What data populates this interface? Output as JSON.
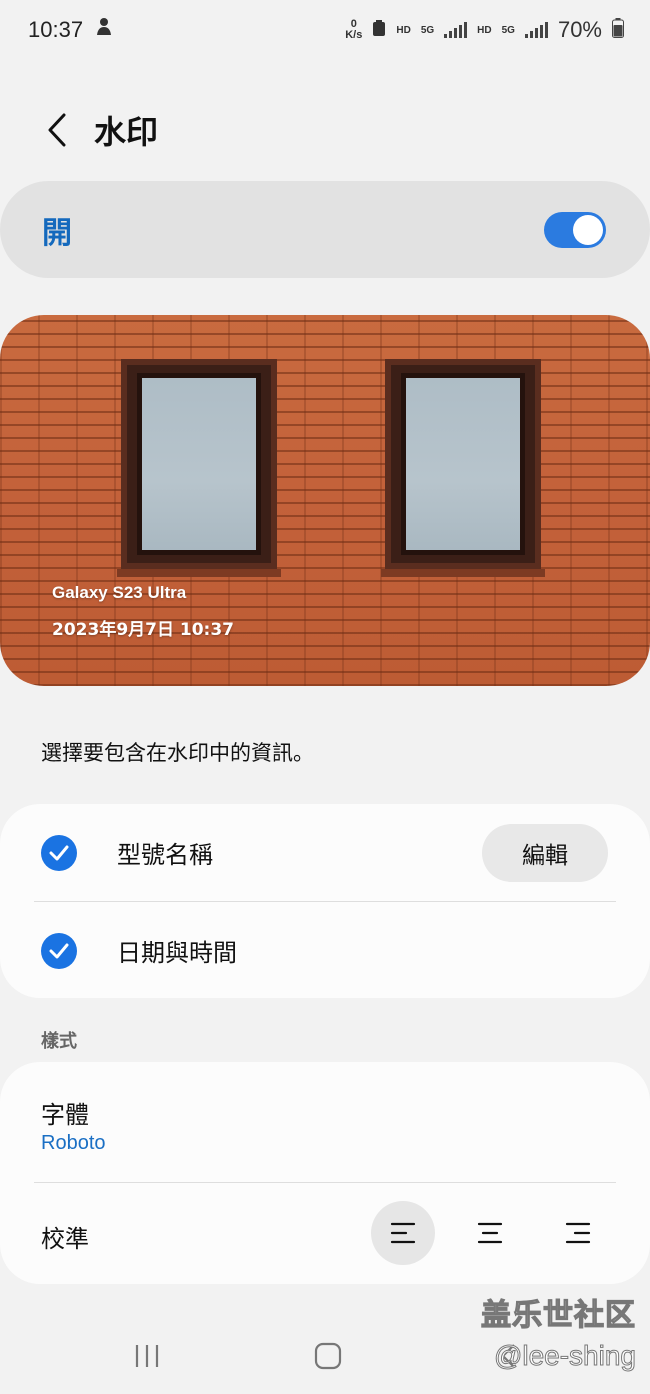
{
  "status_bar": {
    "time": "10:37",
    "net_speed_value": "0",
    "net_speed_unit": "K/s",
    "hd_1": "HD",
    "fiveg_1": "5G",
    "hd_2": "HD",
    "fiveg_2": "5G",
    "battery": "70%"
  },
  "header": {
    "title": "水印"
  },
  "master_switch": {
    "label": "開",
    "state": "on"
  },
  "preview": {
    "watermark_model": "Galaxy S23 Ultra",
    "watermark_datetime": "2023年9月7日 10:37"
  },
  "description": "選擇要包含在水印中的資訊。",
  "info_options": {
    "model_name_label": "型號名稱",
    "model_name_checked": true,
    "edit_label": "編輯",
    "date_time_label": "日期與時間",
    "date_time_checked": true
  },
  "style_section": {
    "header": "樣式",
    "font_label": "字體",
    "font_value": "Roboto",
    "alignment_label": "校準",
    "alignment_selected": "left"
  },
  "overlay": {
    "site": "盖乐世社区",
    "user": "@lee-shing"
  },
  "colors": {
    "accent": "#1a73e2",
    "switch_label": "#1469bd",
    "font_value": "#1a6fc4",
    "background": "#f2f2f2",
    "card": "#fcfcfc"
  }
}
